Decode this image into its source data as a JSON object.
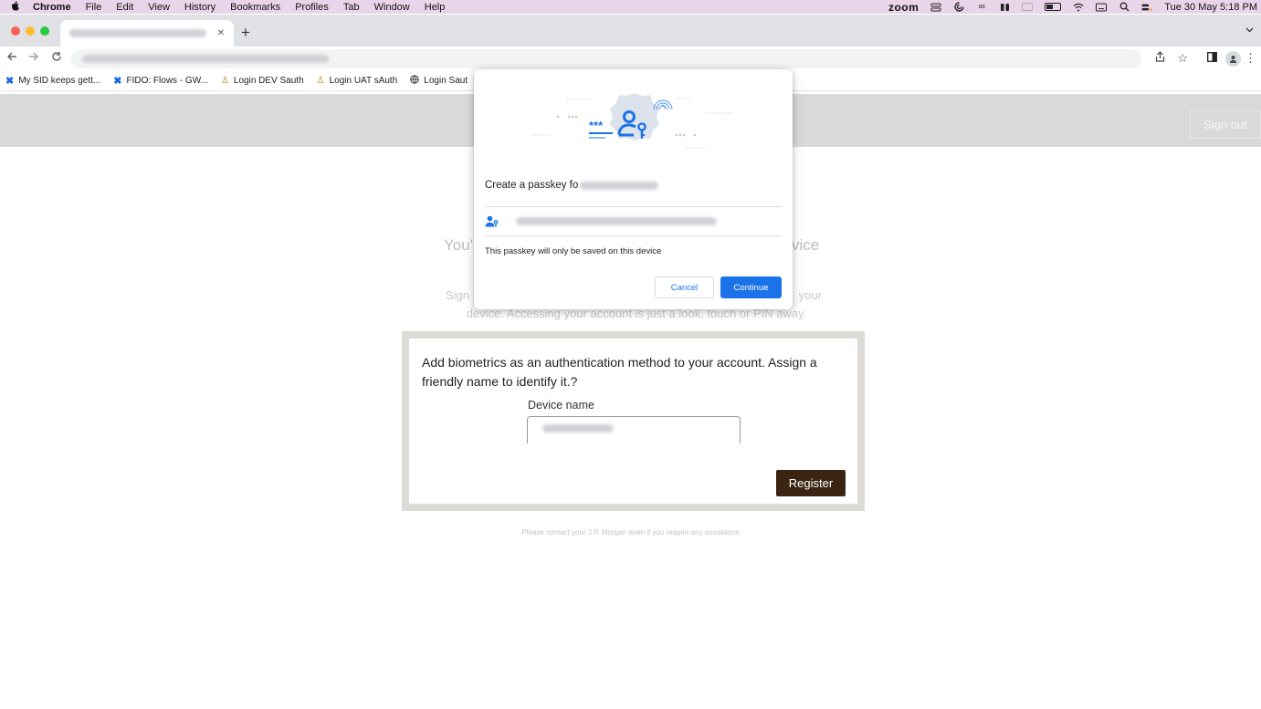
{
  "os_menubar": {
    "app_name": "Chrome",
    "menus": [
      "File",
      "Edit",
      "View",
      "History",
      "Bookmarks",
      "Profiles",
      "Tab",
      "Window",
      "Help"
    ],
    "zoom_label": "zoom",
    "clock": "Tue 30 May  5:18 PM"
  },
  "browser": {
    "new_tab_symbol": "+",
    "bookmarks": [
      {
        "label": "My SID keeps gett...",
        "icon": "confluence-icon"
      },
      {
        "label": "FIDO: Flows - GW...",
        "icon": "confluence-icon"
      },
      {
        "label": "Login DEV Sauth",
        "icon": "person-icon"
      },
      {
        "label": "Login UAT sAuth",
        "icon": "person-icon"
      },
      {
        "label": "Login Saut",
        "icon": "globe-icon"
      }
    ]
  },
  "page": {
    "sign_out_label": "Sign out",
    "heading_left": "You'",
    "heading_right": "vice",
    "sub_line1_left": "Sign",
    "sub_line1_right": "your",
    "sub_line2": "device. Accessing your account is just a look, touch or PIN away.",
    "biometric_card": {
      "prompt": "Add biometrics as an authentication method to your account. Assign a friendly name to identify it.?",
      "device_label": "Device name",
      "register_label": "Register"
    },
    "footer_note": "Please contact your J.P. Morgan team if you require any assistance"
  },
  "passkey_dialog": {
    "title": "Create a passkey fo",
    "note": "This passkey will only be saved on this device",
    "cancel_label": "Cancel",
    "continue_label": "Continue",
    "accent_color": "#1a73e8"
  },
  "colors": {
    "register_button": "#3b2412",
    "header_bar": "#d9d9d9",
    "menubar": "#e9d5ea"
  }
}
